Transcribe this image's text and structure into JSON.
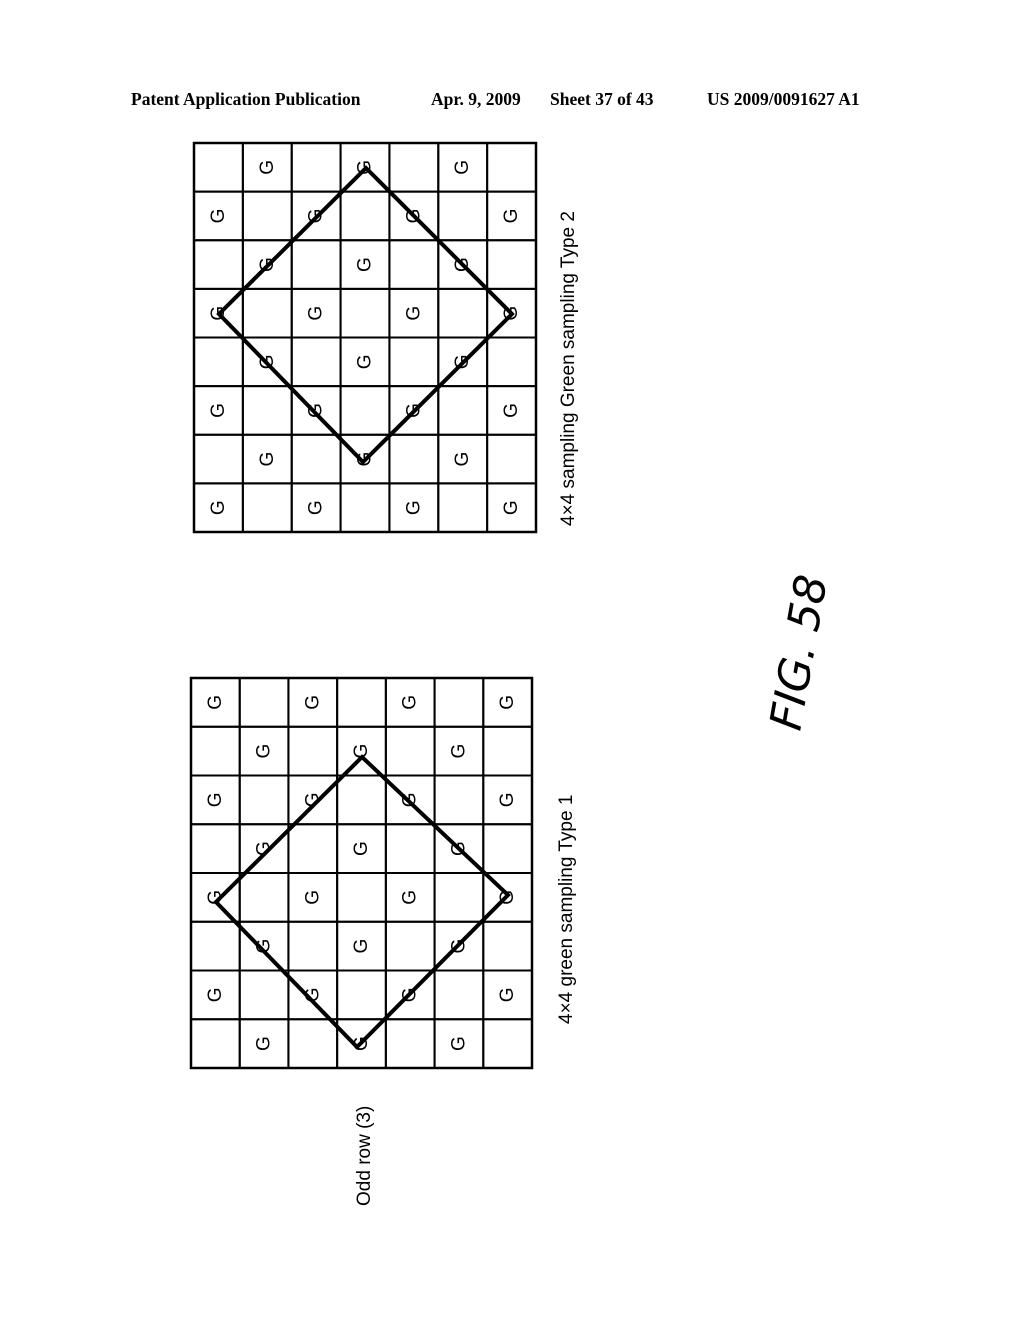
{
  "header": {
    "publication": "Patent Application Publication",
    "date": "Apr. 9, 2009",
    "sheet": "Sheet 37 of 43",
    "number": "US 2009/0091627 A1"
  },
  "figure_label": "FIG. 58",
  "grids": [
    {
      "id": "type2",
      "caption": "4×4 sampling Green sampling Type 2",
      "rows": [
        [
          "",
          "G",
          "",
          "G",
          "",
          "G",
          ""
        ],
        [
          "G",
          "",
          "G",
          "",
          "G",
          "",
          "G"
        ],
        [
          "",
          "G",
          "",
          "G",
          "",
          "G",
          ""
        ],
        [
          "G",
          "",
          "G",
          "",
          "G",
          "",
          "G"
        ],
        [
          "",
          "G",
          "",
          "G",
          "",
          "G",
          ""
        ],
        [
          "G",
          "",
          "G",
          "",
          "G",
          "",
          "G"
        ],
        [
          "",
          "G",
          "",
          "G",
          "",
          "G",
          ""
        ],
        [
          "G",
          "",
          "G",
          "",
          "G",
          "",
          "G"
        ]
      ]
    },
    {
      "id": "type1",
      "caption": "4×4 green sampling Type 1",
      "side_label": "Odd row (3)",
      "rows": [
        [
          "G",
          "",
          "G",
          "",
          "G",
          "",
          "G"
        ],
        [
          "",
          "G",
          "",
          "G",
          "",
          "G",
          ""
        ],
        [
          "G",
          "",
          "G",
          "",
          "G",
          "",
          "G"
        ],
        [
          "",
          "G",
          "",
          "G",
          "",
          "G",
          ""
        ],
        [
          "G",
          "",
          "G",
          "",
          "G",
          "",
          "G"
        ],
        [
          "",
          "G",
          "",
          "G",
          "",
          "G",
          ""
        ],
        [
          "G",
          "",
          "G",
          "",
          "G",
          "",
          "G"
        ],
        [
          "",
          "G",
          "",
          "G",
          "",
          "G",
          ""
        ]
      ]
    }
  ]
}
